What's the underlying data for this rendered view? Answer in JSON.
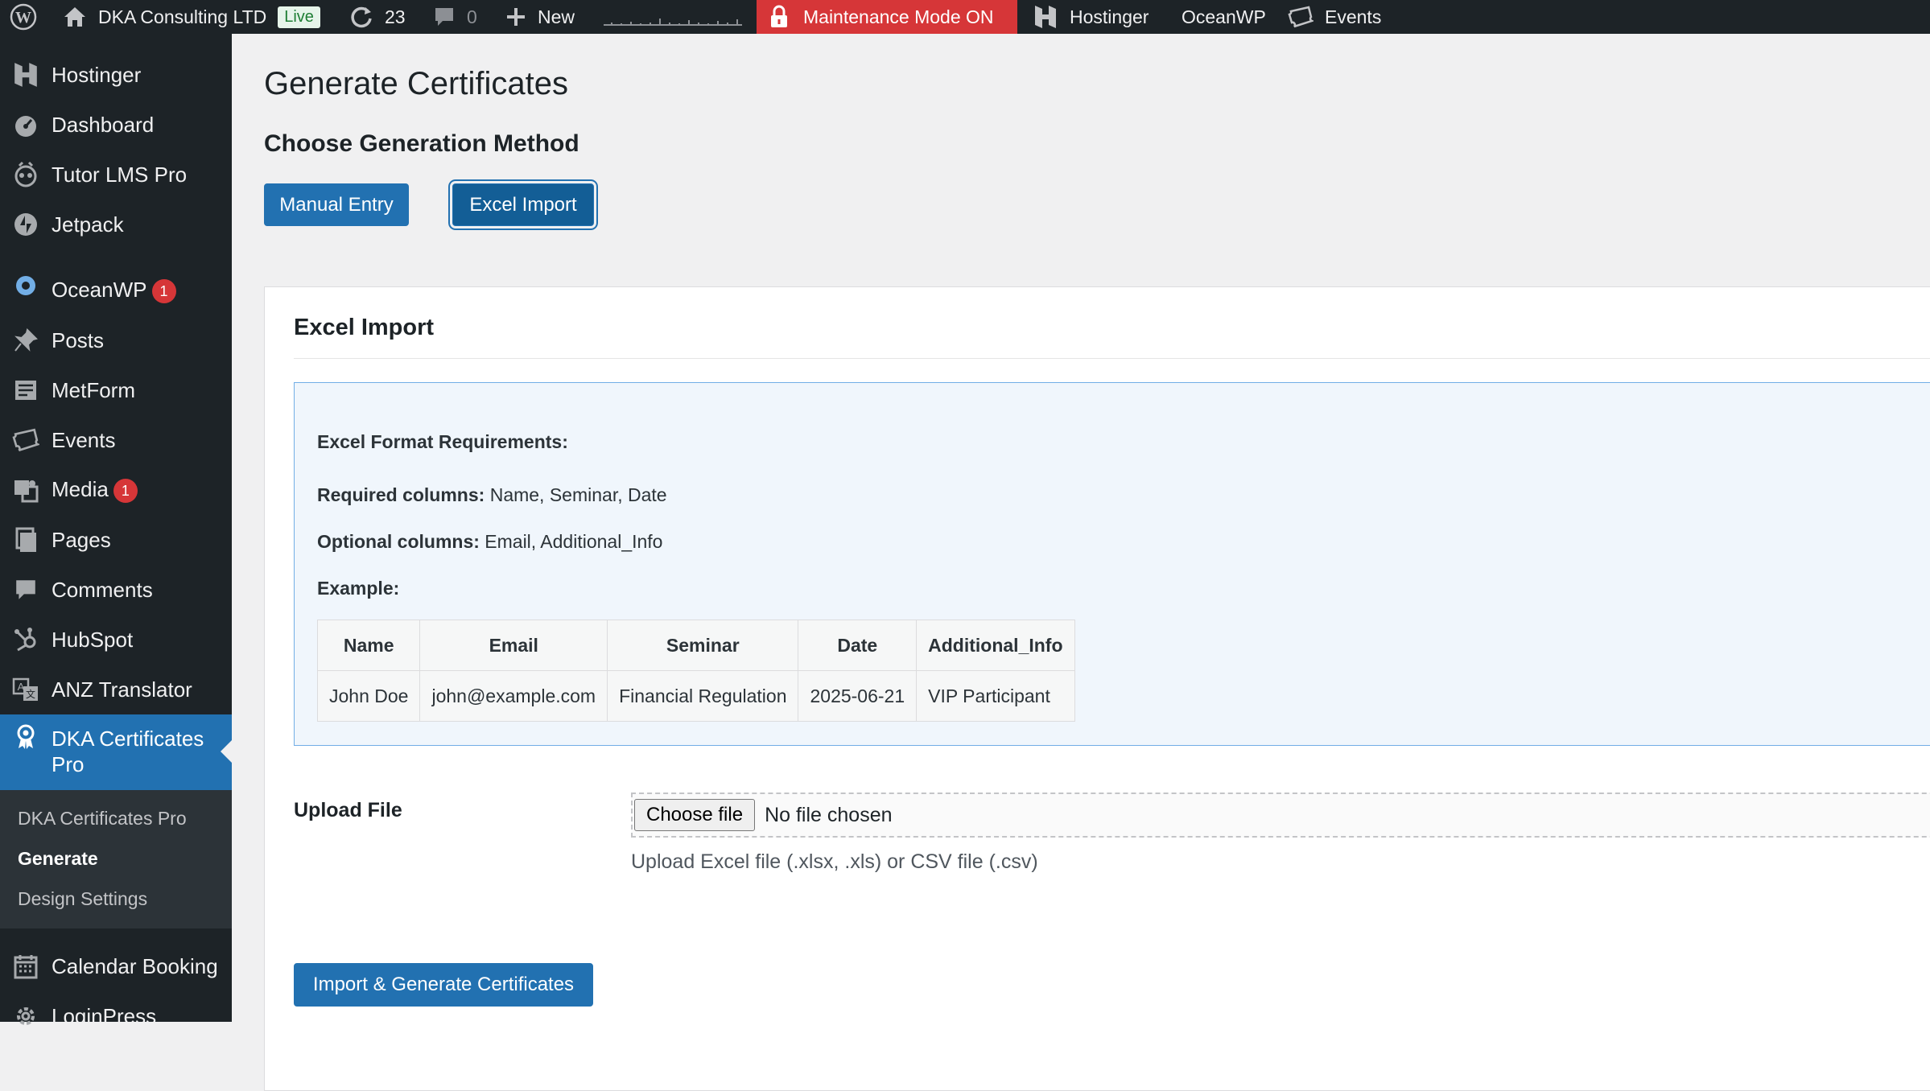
{
  "admin_bar": {
    "site_name": "DKA Consulting LTD",
    "live_label": "Live",
    "updates_count": "23",
    "comments_count": "0",
    "new_label": "New",
    "maintenance_label": "Maintenance Mode ON",
    "hostinger_label": "Hostinger",
    "oceanwp_label": "OceanWP",
    "events_label": "Events",
    "colors": {
      "bar": "#1d2327",
      "maintenance": "#d63638"
    }
  },
  "sidebar": {
    "items": [
      {
        "label": "Hostinger",
        "icon": "hostinger-icon"
      },
      {
        "label": "Dashboard",
        "icon": "dashboard-icon"
      },
      {
        "label": "Tutor LMS Pro",
        "icon": "tutor-icon"
      },
      {
        "label": "Jetpack",
        "icon": "jetpack-icon"
      },
      {
        "label": "OceanWP",
        "icon": "oceanwp-icon",
        "badge": "1"
      },
      {
        "label": "Posts",
        "icon": "pin-icon"
      },
      {
        "label": "MetForm",
        "icon": "form-icon"
      },
      {
        "label": "Events",
        "icon": "ticket-icon"
      },
      {
        "label": "Media",
        "icon": "media-icon",
        "badge": "1"
      },
      {
        "label": "Pages",
        "icon": "pages-icon"
      },
      {
        "label": "Comments",
        "icon": "comment-icon"
      },
      {
        "label": "HubSpot",
        "icon": "hubspot-icon"
      },
      {
        "label": "ANZ Translator",
        "icon": "translate-icon"
      },
      {
        "label": "DKA Certificates Pro",
        "icon": "award-icon",
        "active": true
      },
      {
        "label": "Calendar Booking",
        "icon": "calendar-icon"
      },
      {
        "label": "LoginPress",
        "icon": "gear-icon"
      }
    ],
    "active_label_line1": "DKA Certificates",
    "active_label_line2": "Pro",
    "submenu": [
      "DKA Certificates Pro",
      "Generate",
      "Design Settings"
    ],
    "submenu_current": "Generate"
  },
  "main": {
    "page_title": "Generate Certificates",
    "section_title": "Choose Generation Method",
    "manual_entry_label": "Manual Entry",
    "excel_import_label": "Excel Import",
    "card_title": "Excel Import",
    "requirements": {
      "heading": "Excel Format Requirements:",
      "required_label": "Required columns:",
      "required_value": " Name, Seminar, Date",
      "optional_label": "Optional columns:",
      "optional_value": " Email, Additional_Info",
      "example_label": "Example:"
    },
    "example_table": {
      "headers": [
        "Name",
        "Email",
        "Seminar",
        "Date",
        "Additional_Info"
      ],
      "rows": [
        [
          "John Doe",
          "john@example.com",
          "Financial Regulation",
          "2025-06-21",
          "VIP Participant"
        ]
      ]
    },
    "upload": {
      "label": "Upload File",
      "choose_button": "Choose file",
      "no_file": "No file chosen",
      "help_text": "Upload Excel file (.xlsx, .xls) or CSV file (.csv)"
    },
    "submit_label": "Import & Generate Certificates",
    "colors": {
      "primary": "#2271b1",
      "info_bg": "#f0f6fc",
      "info_border": "#72aee6"
    }
  }
}
